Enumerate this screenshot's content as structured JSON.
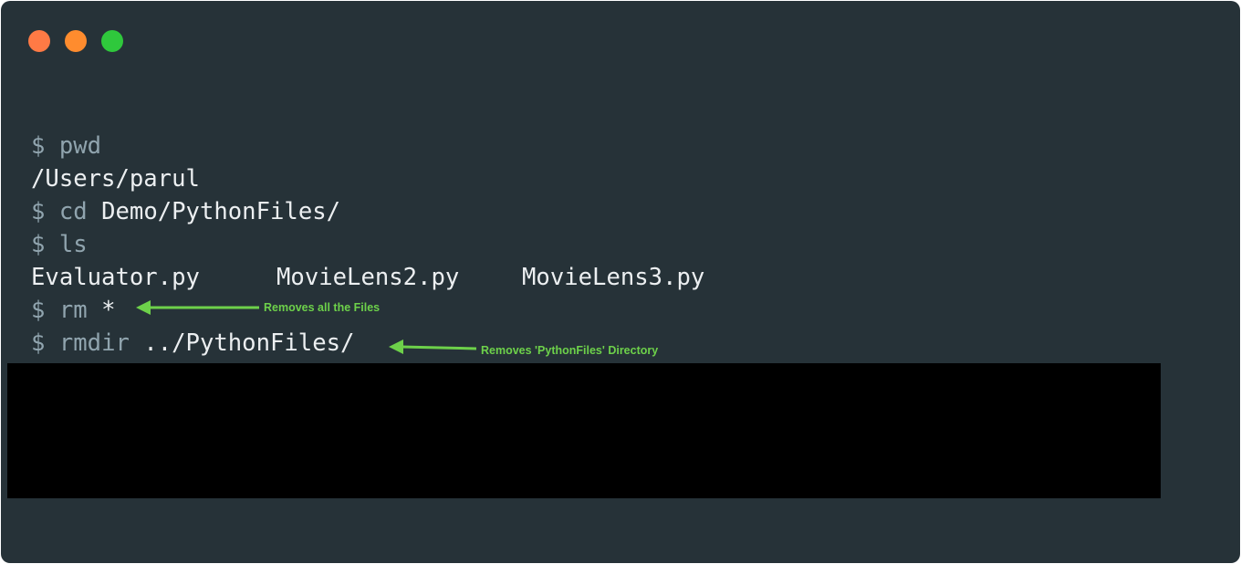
{
  "window": {
    "background": "#263238",
    "buttons": [
      {
        "name": "close",
        "color": "#ff7a45"
      },
      {
        "name": "minimize",
        "color": "#ff8c2e"
      },
      {
        "name": "maximize",
        "color": "#2fc83c"
      }
    ]
  },
  "terminal": {
    "prompt_symbol": "$",
    "lines": [
      {
        "type": "command",
        "command": "pwd",
        "argument": ""
      },
      {
        "type": "output",
        "text": "/Users/parul"
      },
      {
        "type": "command",
        "command": "cd",
        "argument": "Demo/PythonFiles/"
      },
      {
        "type": "command",
        "command": "ls",
        "argument": ""
      },
      {
        "type": "output_files",
        "files": [
          "Evaluator.py",
          "MovieLens2.py",
          "MovieLens3.py"
        ]
      },
      {
        "type": "command",
        "command": "rm",
        "argument": "*"
      },
      {
        "type": "command",
        "command": "rmdir",
        "argument": "../PythonFiles/"
      }
    ]
  },
  "annotations": {
    "rm": "Removes all the Files",
    "rmdir": "Removes 'PythonFiles' Directory",
    "color": "#6dd14a"
  },
  "redaction": {
    "color": "#000000"
  }
}
